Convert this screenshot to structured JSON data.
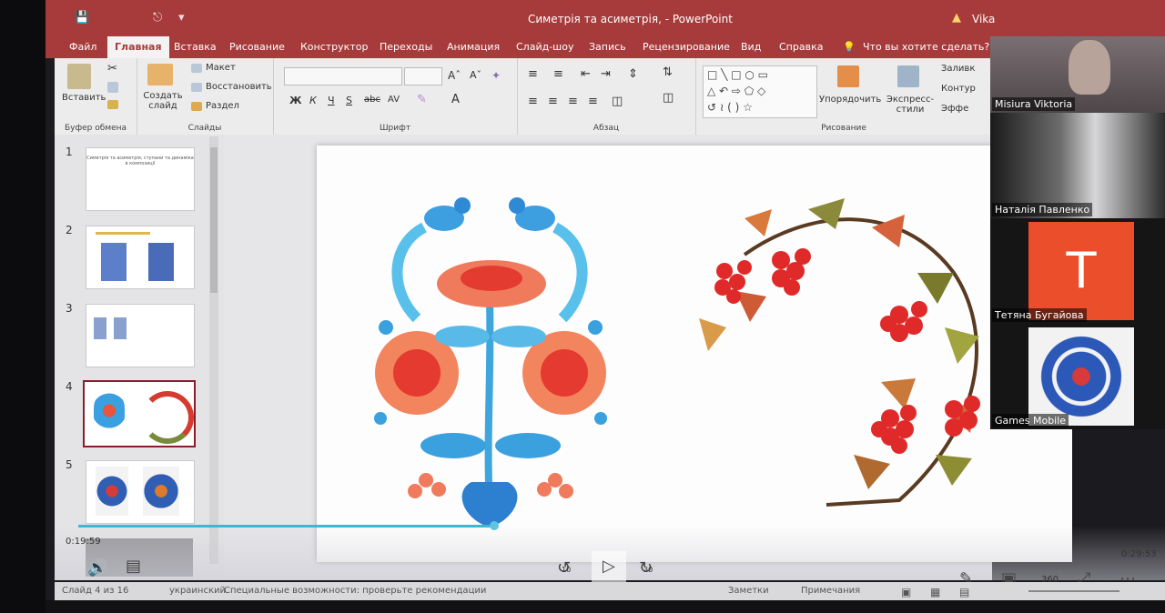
{
  "window": {
    "title": "Симетрія та асиметрія,  - PowerPoint",
    "user": "Vika"
  },
  "menu_tabs": [
    "Файл",
    "Главная",
    "Вставка",
    "Рисование",
    "Конструктор",
    "Переходы",
    "Анимация",
    "Слайд-шоу",
    "Запись",
    "Рецензирование",
    "Вид",
    "Справка"
  ],
  "active_tab_index": 1,
  "search_hint": "Что вы хотите сделать?",
  "ribbon": {
    "clipboard": {
      "paste_label": "Вставить",
      "group_label": "Буфер обмена"
    },
    "slides": {
      "new_slide_label": "Создать слайд",
      "layout_label": "Макет",
      "reset_label": "Восстановить",
      "section_label": "Раздел",
      "group_label": "Слайды"
    },
    "font": {
      "group_label": "Шрифт",
      "bold": "Ж",
      "italic": "К",
      "underline": "Ч",
      "strike": "S",
      "abc": "abc",
      "spacing": "AV"
    },
    "paragraph": {
      "group_label": "Абзац"
    },
    "drawing": {
      "arrange_label": "Упорядочить",
      "quick_styles_label": "Экспресс-стили",
      "fill_label": "Заливк",
      "outline_label": "Контур",
      "effects_label": "Эффе",
      "group_label": "Рисование"
    }
  },
  "thumbnails": [
    {
      "number": "1",
      "text": "Симетрія та асиметрія, ступани та динаміка в композиції"
    },
    {
      "number": "2",
      "text": ""
    },
    {
      "number": "3",
      "text": ""
    },
    {
      "number": "4",
      "text": ""
    },
    {
      "number": "5",
      "text": ""
    }
  ],
  "active_slide": 4,
  "participants": [
    {
      "name": "Misiura Viktoria",
      "kind": "video"
    },
    {
      "name": "Наталія Павленко",
      "kind": "video"
    },
    {
      "name": "Тетяна Бугайова",
      "kind": "avatar",
      "initial": "T",
      "color": "#ea4e2b"
    },
    {
      "name": "Games Mobile",
      "kind": "image"
    }
  ],
  "media": {
    "elapsed": "0:19:59",
    "remaining": "0:29:53",
    "progress_fraction": 0.38,
    "rewind_label": "10",
    "forward_label": "30",
    "view_360_label": "360"
  },
  "status": {
    "slide_info": "Слайд 4 из 16",
    "language": "украинский",
    "accessibility": "Специальные возможности: проверьте рекомендации",
    "notes_label": "Заметки",
    "comments_label": "Примечания"
  },
  "colors": {
    "brand": "#a73b3b",
    "progress": "#3fb6d8"
  }
}
